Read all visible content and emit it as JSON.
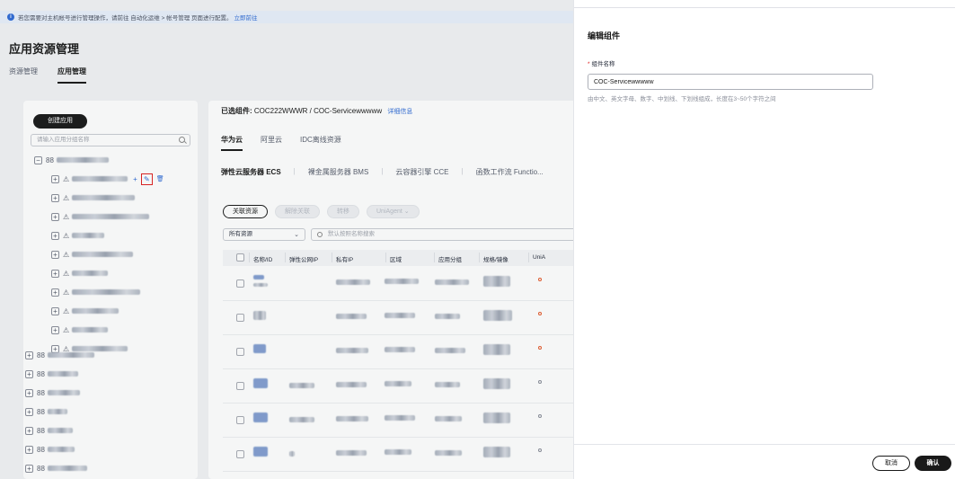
{
  "notice": {
    "icon": "info-icon",
    "text": "若您需要对主机帐号进行管理操作，请前往 自动化运维 > 帐号管理 页面进行配置。",
    "link": "立即前往"
  },
  "page": {
    "title": "应用资源管理",
    "tabs": [
      "资源管理",
      "应用管理"
    ],
    "active_tab": "应用管理"
  },
  "tree": {
    "create_button": "创建应用",
    "search_placeholder": "请输入应用分组名称",
    "row_actions": {
      "add": "+",
      "edit": "✎",
      "delete": "🗑"
    }
  },
  "main": {
    "selected_label": "已选组件:",
    "selected_value": "COC222WWWR / COC-Servicewwwww",
    "detail_link": "详细信息",
    "cloud_tabs": [
      "华为云",
      "阿里云",
      "IDC离线资源"
    ],
    "active_cloud_tab": "华为云",
    "service_tabs": [
      "弹性云服务器 ECS",
      "裸金属服务器 BMS",
      "云容器引擎 CCE",
      "函数工作流 Functio..."
    ],
    "active_service_tab": "弹性云服务器 ECS",
    "buttons": {
      "associate": "关联资源",
      "disassociate": "解除关联",
      "transfer": "转移",
      "uniagent": "UniAgent"
    },
    "filter_select": "所有资源",
    "search_placeholder": "默认按照名称搜索",
    "columns": [
      "名称/ID",
      "弹性公网IP",
      "私有IP",
      "区域",
      "应用分组",
      "规格/镜像",
      "UniA"
    ]
  },
  "drawer": {
    "title": "编辑组件",
    "required_mark": "*",
    "field_label": "组件名称",
    "field_value": "COC-Servicewwwww",
    "field_hint": "由中文、英文字母、数字、中划线、下划线组成，长度在3~50个字符之间",
    "cancel_button": "取消",
    "confirm_button": "确认"
  },
  "colors": {
    "primary_dark": "#191919",
    "link_blue": "#2f6bd6",
    "error_red": "#e02020",
    "status_orange": "#e65c2e"
  }
}
